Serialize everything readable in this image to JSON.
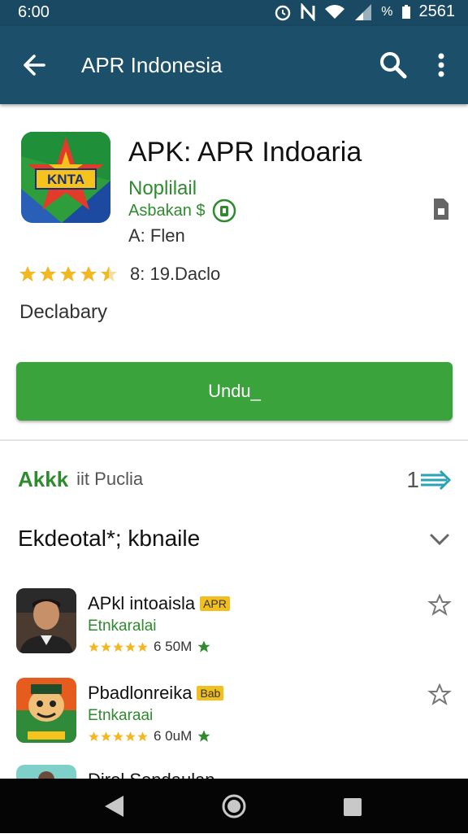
{
  "status": {
    "time": "6:00",
    "battery_percent": "%",
    "clock_right": "2561"
  },
  "appbar": {
    "title": "APR Indonesia"
  },
  "app": {
    "title": "APK: APR Indoaria",
    "developer": "Noplilail",
    "developer_sub": "Asbakan $",
    "age_rating": "A: Flen",
    "rating_text": "8: 19.Daclo",
    "rating_stars": 4.5,
    "category": "Declabary",
    "install_label": "Undu_"
  },
  "similar": {
    "label": "Akkk",
    "sub": "iit  Puclia",
    "count": "1"
  },
  "section": {
    "title": "Ekdeotal*; kbnaile"
  },
  "list": [
    {
      "title": "APkl intoaisla",
      "tag": "APR",
      "subtitle": "Etnkaralai",
      "size": "6 50M"
    },
    {
      "title": "Pbadlonreika",
      "tag": "Bab",
      "subtitle": "Etnkaraai",
      "size": "6 0uM"
    },
    {
      "title": "Dirol Sondaulan",
      "tag": "",
      "subtitle": "",
      "size": ""
    }
  ],
  "colors": {
    "appbar": "#1c4f6a",
    "statusbar": "#1a4a63",
    "accent_green": "#3ba33b",
    "star_gold": "#f2b824"
  }
}
